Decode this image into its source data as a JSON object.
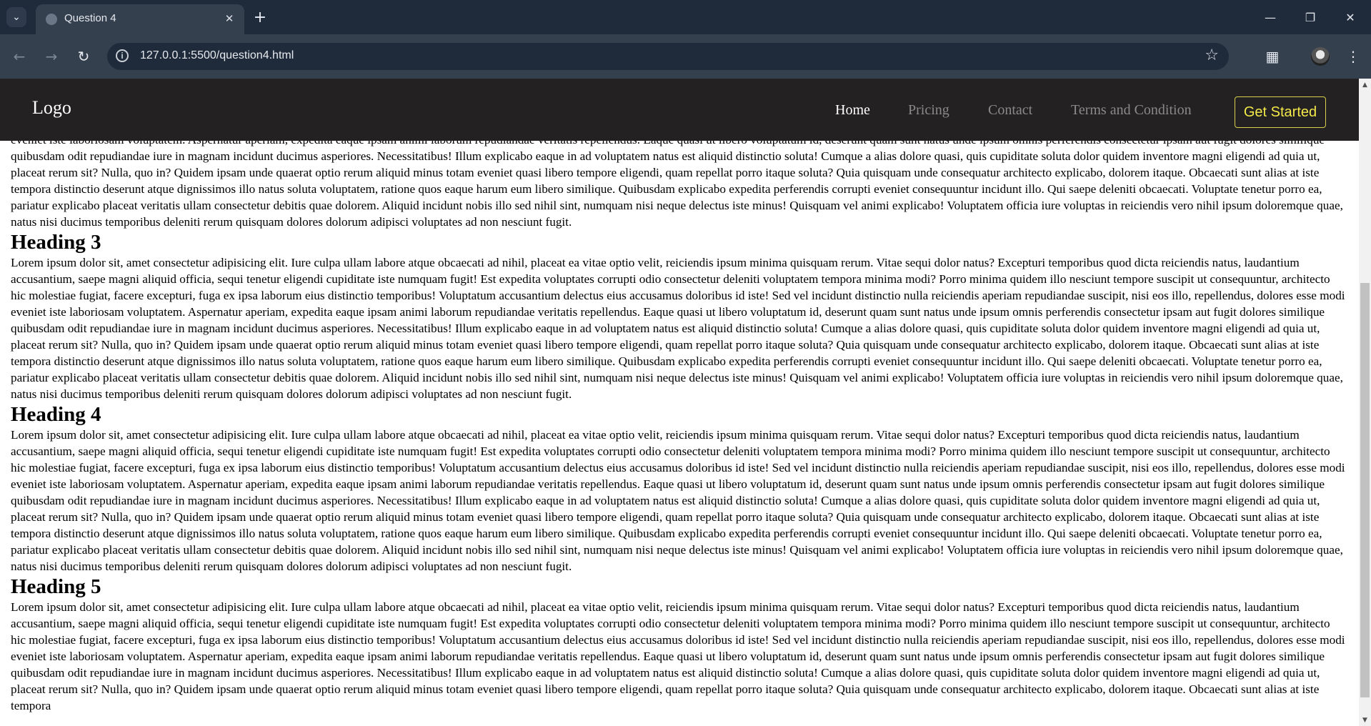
{
  "browser": {
    "tab_title": "Question 4",
    "url": "127.0.0.1:5500/question4.html",
    "icons": {
      "tab_search": "chevron-down-icon",
      "new_tab": "plus-icon",
      "minimize": "minimize-icon",
      "restore": "restore-icon",
      "close": "close-icon",
      "back": "arrow-left-icon",
      "forward": "arrow-right-icon",
      "reload": "reload-icon",
      "site_info": "info-icon",
      "bookmark": "star-icon",
      "extensions": "puzzle-icon",
      "profile": "avatar",
      "menu": "kebab-menu-icon"
    }
  },
  "site": {
    "logo": "Logo",
    "nav_links": [
      "Home",
      "Pricing",
      "Contact",
      "Terms and Condition"
    ],
    "active_link": "Home",
    "cta_label": "Get Started",
    "colors": {
      "nav_bg": "#242122",
      "nav_active": "#ffffff",
      "nav_inactive": "#8a8a8a",
      "cta": "#f2e84a"
    }
  },
  "content": {
    "partial_paragraph": "Lorem ipsum dolor sit, amet consectetur adipisicing elit. Iure culpa ullam labore atque obcaecati ad nihil, placeat ea vitae optio velit, reiciendis ipsum minima quisquam rerum. Vitae sequi dolor natus? Excepturi temporibus quod dicta reiciendis natus, laudantium accusantium, saepe magni aliquid officia, sequi tenetur eligendi cupiditate iste numquam fugit! Est expedita voluptates corrupti odio consectetur deleniti voluptatem tempora minima modi? Porro minima quidem illo nesciunt tempore suscipit ut consequuntur, architecto hic molestiae fugiat, facere excepturi, fuga ex ipsa laborum eius distinctio temporibus! Voluptatum accusantium delectus eius accusamus doloribus id iste! Sed vel incidunt distinctio nulla reiciendis aperiam repudiandae suscipit, nisi eos illo, repellendus, dolores esse modi eveniet iste laboriosam voluptatem. Aspernatur aperiam, expedita eaque ipsam animi laborum repudiandae veritatis repellendus. Eaque quasi ut libero voluptatum id, deserunt quam sunt natus unde ipsum omnis perferendis consectetur ipsam aut fugit dolores similique quibusdam odit repudiandae iure in magnam incidunt ducimus asperiores. Necessitatibus! Illum explicabo eaque in ad voluptatem natus est aliquid distinctio soluta! Cumque a alias dolore quasi, quis cupiditate soluta dolor quidem inventore magni eligendi ad quia ut, placeat rerum sit? Nulla, quo in? Quidem ipsam unde quaerat optio rerum aliquid minus totam eveniet quasi libero tempore eligendi, quam repellat porro itaque soluta? Quia quisquam unde consequatur architecto explicabo, dolorem itaque. Obcaecati sunt alias at iste tempora distinctio deserunt atque dignissimos illo natus soluta voluptatem, ratione quos eaque harum eum libero similique. Quibusdam explicabo expedita perferendis corrupti eveniet consequuntur incidunt illo. Qui saepe deleniti obcaecati. Voluptate tenetur porro ea, pariatur explicabo placeat veritatis ullam consectetur debitis quae dolorem. Aliquid incidunt nobis illo sed nihil sint, numquam nisi neque delectus iste minus! Quisquam vel animi explicabo! Voluptatem officia iure voluptas in reiciendis vero nihil ipsum doloremque quae, natus nisi ducimus temporibus deleniti rerum quisquam dolores dolorum adipisci voluptates ad non nesciunt fugit.",
    "sections": [
      {
        "heading": "Heading 3",
        "body": "Lorem ipsum dolor sit, amet consectetur adipisicing elit. Iure culpa ullam labore atque obcaecati ad nihil, placeat ea vitae optio velit, reiciendis ipsum minima quisquam rerum. Vitae sequi dolor natus? Excepturi temporibus quod dicta reiciendis natus, laudantium accusantium, saepe magni aliquid officia, sequi tenetur eligendi cupiditate iste numquam fugit! Est expedita voluptates corrupti odio consectetur deleniti voluptatem tempora minima modi? Porro minima quidem illo nesciunt tempore suscipit ut consequuntur, architecto hic molestiae fugiat, facere excepturi, fuga ex ipsa laborum eius distinctio temporibus! Voluptatum accusantium delectus eius accusamus doloribus id iste! Sed vel incidunt distinctio nulla reiciendis aperiam repudiandae suscipit, nisi eos illo, repellendus, dolores esse modi eveniet iste laboriosam voluptatem. Aspernatur aperiam, expedita eaque ipsam animi laborum repudiandae veritatis repellendus. Eaque quasi ut libero voluptatum id, deserunt quam sunt natus unde ipsum omnis perferendis consectetur ipsam aut fugit dolores similique quibusdam odit repudiandae iure in magnam incidunt ducimus asperiores. Necessitatibus! Illum explicabo eaque in ad voluptatem natus est aliquid distinctio soluta! Cumque a alias dolore quasi, quis cupiditate soluta dolor quidem inventore magni eligendi ad quia ut, placeat rerum sit? Nulla, quo in? Quidem ipsam unde quaerat optio rerum aliquid minus totam eveniet quasi libero tempore eligendi, quam repellat porro itaque soluta? Quia quisquam unde consequatur architecto explicabo, dolorem itaque. Obcaecati sunt alias at iste tempora distinctio deserunt atque dignissimos illo natus soluta voluptatem, ratione quos eaque harum eum libero similique. Quibusdam explicabo expedita perferendis corrupti eveniet consequuntur incidunt illo. Qui saepe deleniti obcaecati. Voluptate tenetur porro ea, pariatur explicabo placeat veritatis ullam consectetur debitis quae dolorem. Aliquid incidunt nobis illo sed nihil sint, numquam nisi neque delectus iste minus! Quisquam vel animi explicabo! Voluptatem officia iure voluptas in reiciendis vero nihil ipsum doloremque quae, natus nisi ducimus temporibus deleniti rerum quisquam dolores dolorum adipisci voluptates ad non nesciunt fugit."
      },
      {
        "heading": "Heading 4",
        "body": "Lorem ipsum dolor sit, amet consectetur adipisicing elit. Iure culpa ullam labore atque obcaecati ad nihil, placeat ea vitae optio velit, reiciendis ipsum minima quisquam rerum. Vitae sequi dolor natus? Excepturi temporibus quod dicta reiciendis natus, laudantium accusantium, saepe magni aliquid officia, sequi tenetur eligendi cupiditate iste numquam fugit! Est expedita voluptates corrupti odio consectetur deleniti voluptatem tempora minima modi? Porro minima quidem illo nesciunt tempore suscipit ut consequuntur, architecto hic molestiae fugiat, facere excepturi, fuga ex ipsa laborum eius distinctio temporibus! Voluptatum accusantium delectus eius accusamus doloribus id iste! Sed vel incidunt distinctio nulla reiciendis aperiam repudiandae suscipit, nisi eos illo, repellendus, dolores esse modi eveniet iste laboriosam voluptatem. Aspernatur aperiam, expedita eaque ipsam animi laborum repudiandae veritatis repellendus. Eaque quasi ut libero voluptatum id, deserunt quam sunt natus unde ipsum omnis perferendis consectetur ipsam aut fugit dolores similique quibusdam odit repudiandae iure in magnam incidunt ducimus asperiores. Necessitatibus! Illum explicabo eaque in ad voluptatem natus est aliquid distinctio soluta! Cumque a alias dolore quasi, quis cupiditate soluta dolor quidem inventore magni eligendi ad quia ut, placeat rerum sit? Nulla, quo in? Quidem ipsam unde quaerat optio rerum aliquid minus totam eveniet quasi libero tempore eligendi, quam repellat porro itaque soluta? Quia quisquam unde consequatur architecto explicabo, dolorem itaque. Obcaecati sunt alias at iste tempora distinctio deserunt atque dignissimos illo natus soluta voluptatem, ratione quos eaque harum eum libero similique. Quibusdam explicabo expedita perferendis corrupti eveniet consequuntur incidunt illo. Qui saepe deleniti obcaecati. Voluptate tenetur porro ea, pariatur explicabo placeat veritatis ullam consectetur debitis quae dolorem. Aliquid incidunt nobis illo sed nihil sint, numquam nisi neque delectus iste minus! Quisquam vel animi explicabo! Voluptatem officia iure voluptas in reiciendis vero nihil ipsum doloremque quae, natus nisi ducimus temporibus deleniti rerum quisquam dolores dolorum adipisci voluptates ad non nesciunt fugit."
      },
      {
        "heading": "Heading 5",
        "body": "Lorem ipsum dolor sit, amet consectetur adipisicing elit. Iure culpa ullam labore atque obcaecati ad nihil, placeat ea vitae optio velit, reiciendis ipsum minima quisquam rerum. Vitae sequi dolor natus? Excepturi temporibus quod dicta reiciendis natus, laudantium accusantium, saepe magni aliquid officia, sequi tenetur eligendi cupiditate iste numquam fugit! Est expedita voluptates corrupti odio consectetur deleniti voluptatem tempora minima modi? Porro minima quidem illo nesciunt tempore suscipit ut consequuntur, architecto hic molestiae fugiat, facere excepturi, fuga ex ipsa laborum eius distinctio temporibus! Voluptatum accusantium delectus eius accusamus doloribus id iste! Sed vel incidunt distinctio nulla reiciendis aperiam repudiandae suscipit, nisi eos illo, repellendus, dolores esse modi eveniet iste laboriosam voluptatem. Aspernatur aperiam, expedita eaque ipsam animi laborum repudiandae veritatis repellendus. Eaque quasi ut libero voluptatum id, deserunt quam sunt natus unde ipsum omnis perferendis consectetur ipsam aut fugit dolores similique quibusdam odit repudiandae iure in magnam incidunt ducimus asperiores. Necessitatibus! Illum explicabo eaque in ad voluptatem natus est aliquid distinctio soluta! Cumque a alias dolore quasi, quis cupiditate soluta dolor quidem inventore magni eligendi ad quia ut, placeat rerum sit? Nulla, quo in? Quidem ipsam unde quaerat optio rerum aliquid minus totam eveniet quasi libero tempore eligendi, quam repellat porro itaque soluta? Quia quisquam unde consequatur architecto explicabo, dolorem itaque. Obcaecati sunt alias at iste tempora"
      }
    ]
  }
}
